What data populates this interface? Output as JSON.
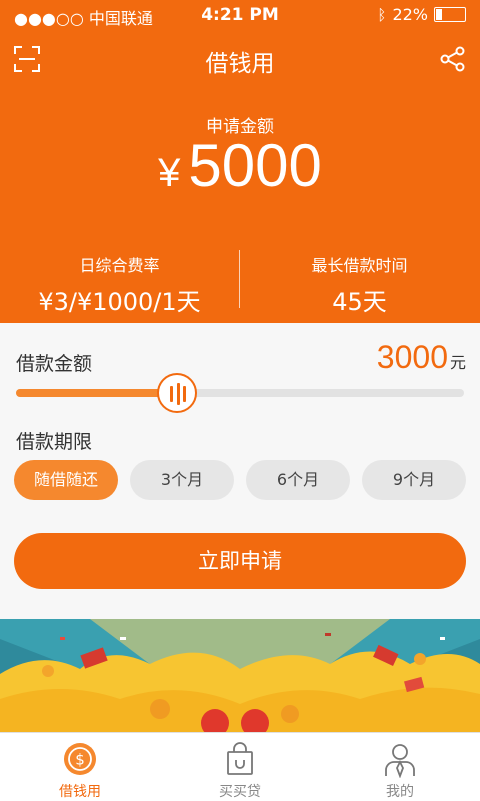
{
  "status_bar": {
    "carrier": "●●●○○ 中国联通",
    "time": "4:21 PM",
    "battery": "22%",
    "battery_level": 0.22
  },
  "nav": {
    "title": "借钱用"
  },
  "summary": {
    "label": "申请金额",
    "currency": "¥",
    "amount": "5000",
    "rate_label": "日综合费率",
    "rate_value": "¥3/¥1000/1天",
    "term_label": "最长借款时间",
    "term_value": "45天"
  },
  "loan": {
    "label": "借款金额",
    "value": "3000",
    "unit": "元",
    "slider_fraction": 0.36
  },
  "period": {
    "label": "借款期限",
    "options": [
      "随借随还",
      "3个月",
      "6个月",
      "9个月"
    ],
    "selected_index": 0
  },
  "apply_button": "立即申请",
  "tabbar": {
    "items": [
      "借钱用",
      "买买贷",
      "我的"
    ],
    "active_index": 0
  },
  "colors": {
    "accent": "#f26a0f",
    "accent_light": "#f5882e",
    "inactive": "#888888"
  }
}
